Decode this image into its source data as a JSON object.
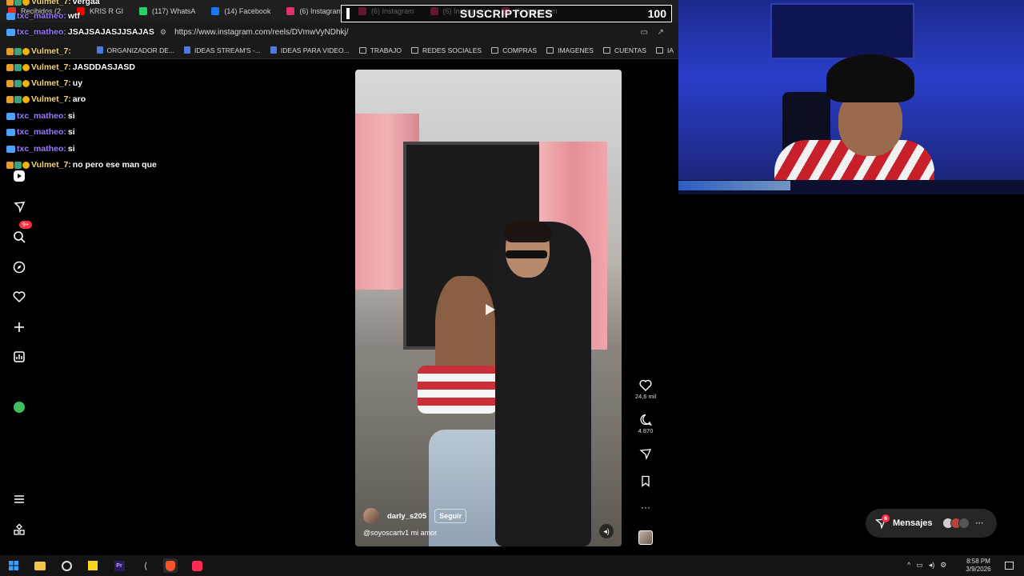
{
  "browser": {
    "tabs": [
      {
        "label": "Recibidos (2",
        "color": "#d93025"
      },
      {
        "label": "KRIS R GI",
        "color": "#ff0000"
      },
      {
        "label": "(117) WhatsA",
        "color": "#25d366"
      },
      {
        "label": "(14) Facebook",
        "color": "#1877f2"
      },
      {
        "label": "(6) Instagram",
        "color": "#e1306c"
      },
      {
        "label": "(6) Instagram",
        "color": "#e1306c"
      },
      {
        "label": "(6) Instagram",
        "color": "#e1306c"
      },
      {
        "label": "(6) Instagram",
        "color": "#e1306c"
      }
    ],
    "url": "https://www.instagram.com/reels/DVmwVyNDhkj/",
    "bookmarks": [
      {
        "label": "ORGANIZADOR DE...",
        "kind": "doc"
      },
      {
        "label": "IDEAS STREAM'S -...",
        "kind": "doc"
      },
      {
        "label": "IDEAS PARA VIDEO...",
        "kind": "doc"
      },
      {
        "label": "TRABAJO",
        "kind": "folder"
      },
      {
        "label": "REDES SOCIALES",
        "kind": "folder"
      },
      {
        "label": "COMPRAS",
        "kind": "folder"
      },
      {
        "label": "IMAGENES",
        "kind": "folder"
      },
      {
        "label": "CUENTAS",
        "kind": "folder"
      },
      {
        "label": "IA",
        "kind": "folder"
      }
    ]
  },
  "overlay": {
    "subscribers_label": "SUSCRIPTORES",
    "subscribers_goal": "100"
  },
  "chat": [
    {
      "user": "Vulmet_7:",
      "text": "vergaa",
      "type": "v"
    },
    {
      "user": "txc_matheo:",
      "text": "wtf",
      "type": "t"
    },
    {
      "user": "txc_matheo:",
      "text": "JSAJSAJASJJSAJAS",
      "type": "t"
    },
    {
      "user": "Vulmet_7:",
      "text": "",
      "type": "v"
    },
    {
      "user": "Vulmet_7:",
      "text": "JASDDASJASD",
      "type": "v"
    },
    {
      "user": "Vulmet_7:",
      "text": "uy",
      "type": "v"
    },
    {
      "user": "Vulmet_7:",
      "text": "aro",
      "type": "v"
    },
    {
      "user": "txc_matheo:",
      "text": "si",
      "type": "t"
    },
    {
      "user": "txc_matheo:",
      "text": "si",
      "type": "t"
    },
    {
      "user": "txc_matheo:",
      "text": "si",
      "type": "t"
    },
    {
      "user": "Vulmet_7:",
      "text": "no pero ese man que",
      "type": "v"
    }
  ],
  "sidebar": {
    "notifications_badge": "9+"
  },
  "reel": {
    "username": "darly_s205",
    "follow_label": "Seguir",
    "caption": "@soyoscartv1 mi amor",
    "likes": "24,6 mil",
    "comments": "4.870"
  },
  "messages": {
    "label": "Mensajes",
    "badge": "6"
  },
  "taskbar": {
    "time": "8:58 PM",
    "date": "3/9/2026"
  },
  "colors": {
    "instagram_bg": "#000000",
    "badge_red": "#ff3040",
    "chat_user_v": "#f2d675",
    "chat_user_t": "#9b7bff"
  }
}
